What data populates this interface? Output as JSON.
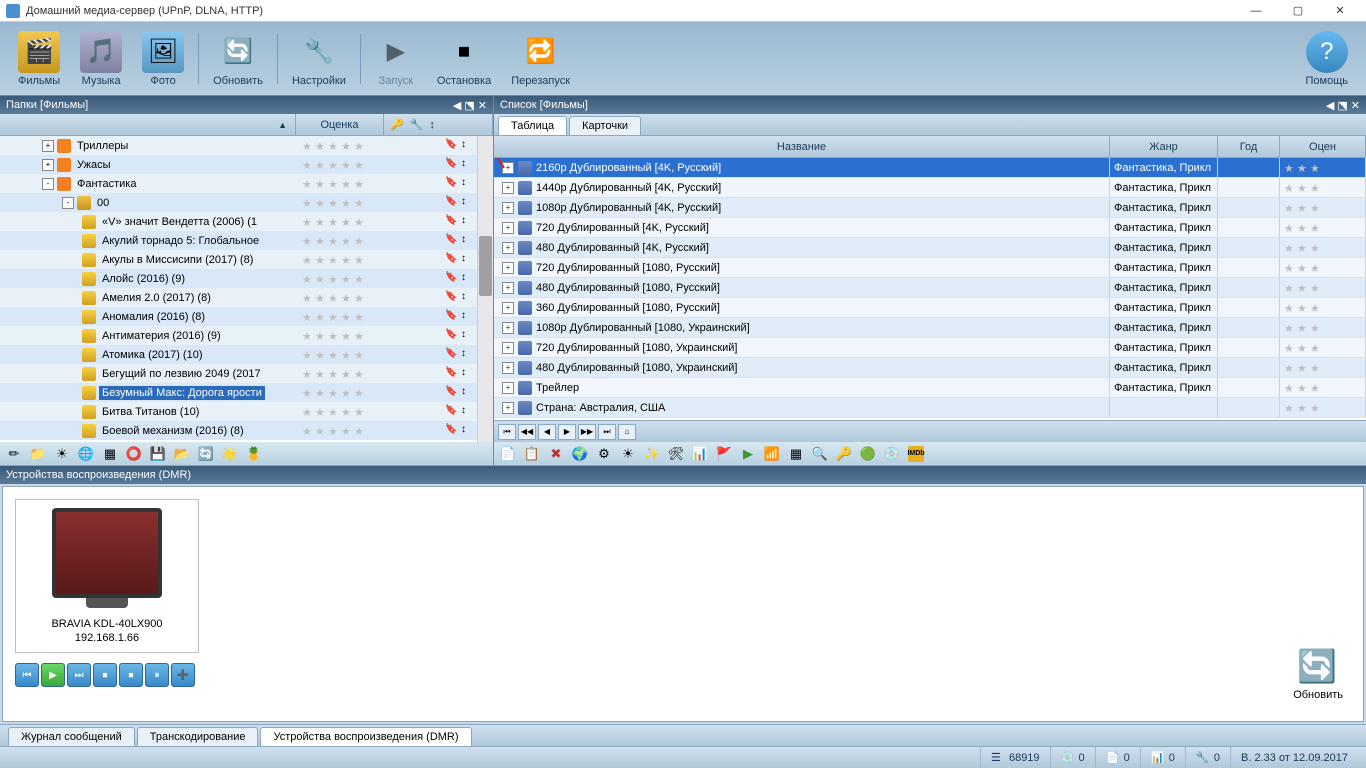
{
  "window": {
    "title": "Домашний медиа-сервер (UPnP, DLNA, HTTP)"
  },
  "toolbar": {
    "films": "Фильмы",
    "music": "Музыка",
    "photo": "Фото",
    "refresh": "Обновить",
    "settings": "Настройки",
    "start": "Запуск",
    "stop": "Остановка",
    "restart": "Перезапуск",
    "help": "Помощь"
  },
  "left_panel": {
    "title": "Папки [Фильмы]",
    "col_rating": "Оценка",
    "items": [
      {
        "indent": 42,
        "expand": "+",
        "icon": "rss",
        "label": "Триллеры"
      },
      {
        "indent": 42,
        "expand": "+",
        "icon": "rss",
        "label": "Ужасы"
      },
      {
        "indent": 42,
        "expand": "-",
        "icon": "rss",
        "label": "Фантастика"
      },
      {
        "indent": 62,
        "expand": "-",
        "icon": "folder",
        "label": "00"
      },
      {
        "indent": 82,
        "icon": "cube",
        "label": "«V» значит Вендетта (2006) (1"
      },
      {
        "indent": 82,
        "icon": "cube",
        "label": "Акулий торнадо 5: Глобальное"
      },
      {
        "indent": 82,
        "icon": "cube",
        "label": "Акулы в Миссисипи (2017) (8)"
      },
      {
        "indent": 82,
        "icon": "cube",
        "label": "Алойс (2016) (9)"
      },
      {
        "indent": 82,
        "icon": "cube",
        "label": "Амелия 2.0 (2017) (8)"
      },
      {
        "indent": 82,
        "icon": "cube",
        "label": "Аномалия (2016) (8)"
      },
      {
        "indent": 82,
        "icon": "cube",
        "label": "Антиматерия (2016) (9)"
      },
      {
        "indent": 82,
        "icon": "cube",
        "label": "Атомика (2017) (10)"
      },
      {
        "indent": 82,
        "icon": "cube",
        "label": "Бегущий по лезвию 2049 (2017"
      },
      {
        "indent": 82,
        "icon": "cube",
        "label": "Безумный Макс: Дорога ярости",
        "selected": true
      },
      {
        "indent": 82,
        "icon": "cube",
        "label": "Битва Титанов (10)"
      },
      {
        "indent": 82,
        "icon": "cube",
        "label": "Боевой механизм (2016) (8)"
      }
    ]
  },
  "right_panel": {
    "title": "Список [Фильмы]",
    "tabs": {
      "table": "Таблица",
      "cards": "Карточки"
    },
    "columns": {
      "name": "Название",
      "genre": "Жанр",
      "year": "Год",
      "rating": "Оцен"
    },
    "rows": [
      {
        "name": "2160p Дублированный [4K, Русский]",
        "genre": "Фантастика, Прикл",
        "selected": true
      },
      {
        "name": "1440p Дублированный [4K, Русский]",
        "genre": "Фантастика, Прикл"
      },
      {
        "name": "1080p Дублированный [4K, Русский]",
        "genre": "Фантастика, Прикл"
      },
      {
        "name": "720 Дублированный [4K, Русский]",
        "genre": "Фантастика, Прикл"
      },
      {
        "name": "480 Дублированный [4K, Русский]",
        "genre": "Фантастика, Прикл"
      },
      {
        "name": "720 Дублированный [1080, Русский]",
        "genre": "Фантастика, Прикл"
      },
      {
        "name": "480 Дублированный [1080, Русский]",
        "genre": "Фантастика, Прикл"
      },
      {
        "name": "360 Дублированный [1080, Русский]",
        "genre": "Фантастика, Прикл"
      },
      {
        "name": "1080p Дублированный [1080, Украинский]",
        "genre": "Фантастика, Прикл"
      },
      {
        "name": "720 Дублированный [1080, Украинский]",
        "genre": "Фантастика, Прикл"
      },
      {
        "name": "480 Дублированный [1080, Украинский]",
        "genre": "Фантастика, Прикл"
      },
      {
        "name": "Трейлер",
        "genre": "Фантастика, Прикл"
      },
      {
        "name": "Страна: Австралия,  США",
        "genre": ""
      }
    ]
  },
  "devices": {
    "title": "Устройства воспроизведения (DMR)",
    "name": "BRAVIA KDL-40LX900",
    "ip": "192.168.1.66",
    "refresh": "Обновить"
  },
  "bottom_tabs": {
    "log": "Журнал сообщений",
    "transcode": "Транскодирование",
    "devices": "Устройства воспроизведения (DMR)"
  },
  "status": {
    "value1": "68919",
    "zero1": "0",
    "zero2": "0",
    "zero3": "0",
    "zero4": "0",
    "version": "В. 2.33 от 12.09.2017"
  }
}
